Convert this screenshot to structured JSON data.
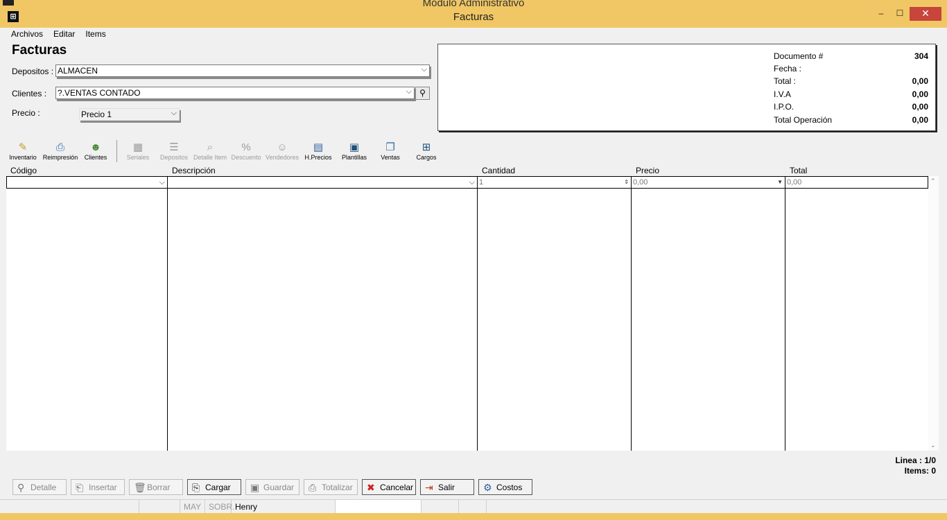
{
  "behind_window_title": "Módulo Administrativo",
  "window": {
    "title": "Facturas",
    "min_glyph": "–",
    "max_glyph": "☐",
    "close_glyph": "✕"
  },
  "menu": [
    "Archivos",
    "Editar",
    "Items"
  ],
  "form": {
    "title": "Facturas",
    "depositos_label": "Depositos :",
    "depositos_value": "ALMACEN",
    "clientes_label": "Clientes  :",
    "clientes_value": "?.VENTAS CONTADO",
    "precio_label": "Precio :",
    "precio_value": "Precio 1"
  },
  "info": [
    {
      "label": "Documento #",
      "value": "304"
    },
    {
      "label": "Fecha :",
      "value": ""
    },
    {
      "label": "Total :",
      "value": "0,00"
    },
    {
      "label": "I.V.A",
      "value": "0,00"
    },
    {
      "label": "I.P.O.",
      "value": "0,00"
    },
    {
      "label": "Total Operación",
      "value": "0,00"
    }
  ],
  "toolbar": [
    {
      "label": "Inventario",
      "icon": "inventory-icon",
      "enabled": true
    },
    {
      "label": "Reimpresión",
      "icon": "printer-icon",
      "enabled": true
    },
    {
      "label": "Clientes",
      "icon": "clients-icon",
      "enabled": true
    },
    {
      "label": "Seriales",
      "icon": "serials-icon",
      "enabled": false
    },
    {
      "label": "Depositos",
      "icon": "warehouse-icon",
      "enabled": false
    },
    {
      "label": "Detalle Item",
      "icon": "item-detail-icon",
      "enabled": false
    },
    {
      "label": "Descuento",
      "icon": "discount-icon",
      "enabled": false
    },
    {
      "label": "Vendedores",
      "icon": "sellers-icon",
      "enabled": false
    },
    {
      "label": "H.Precios",
      "icon": "price-history-icon",
      "enabled": true
    },
    {
      "label": "Plantillas",
      "icon": "templates-icon",
      "enabled": true
    },
    {
      "label": "Ventas",
      "icon": "sales-icon",
      "enabled": true
    },
    {
      "label": "Cargos",
      "icon": "charges-icon",
      "enabled": true
    }
  ],
  "grid": {
    "columns": [
      "Código",
      "Descripción",
      "Cantidad",
      "Precio",
      "Total"
    ],
    "edit_row": {
      "codigo": "",
      "descripcion": "",
      "cantidad": "1",
      "precio": "0,00",
      "total": "0,00"
    }
  },
  "status": {
    "linea": "Linea : 1/0",
    "items": "Items: 0"
  },
  "buttons": [
    {
      "label": "Detalle",
      "icon": "search-icon",
      "enabled": false
    },
    {
      "label": "Insertar",
      "icon": "insert-icon",
      "enabled": false
    },
    {
      "label": "Borrar",
      "icon": "trash-icon",
      "enabled": false
    },
    {
      "label": "Cargar",
      "icon": "load-icon",
      "enabled": true
    },
    {
      "label": "Guardar",
      "icon": "save-icon",
      "enabled": false
    },
    {
      "label": "Totalizar",
      "icon": "totalize-icon",
      "enabled": false
    },
    {
      "label": "Cancelar",
      "icon": "cancel-icon",
      "enabled": true
    },
    {
      "label": "Salir",
      "icon": "exit-icon",
      "enabled": true
    },
    {
      "label": "Costos",
      "icon": "gear-icon",
      "enabled": true
    }
  ],
  "statusbar": [
    "MAY",
    "SOBR.",
    "Henry"
  ]
}
